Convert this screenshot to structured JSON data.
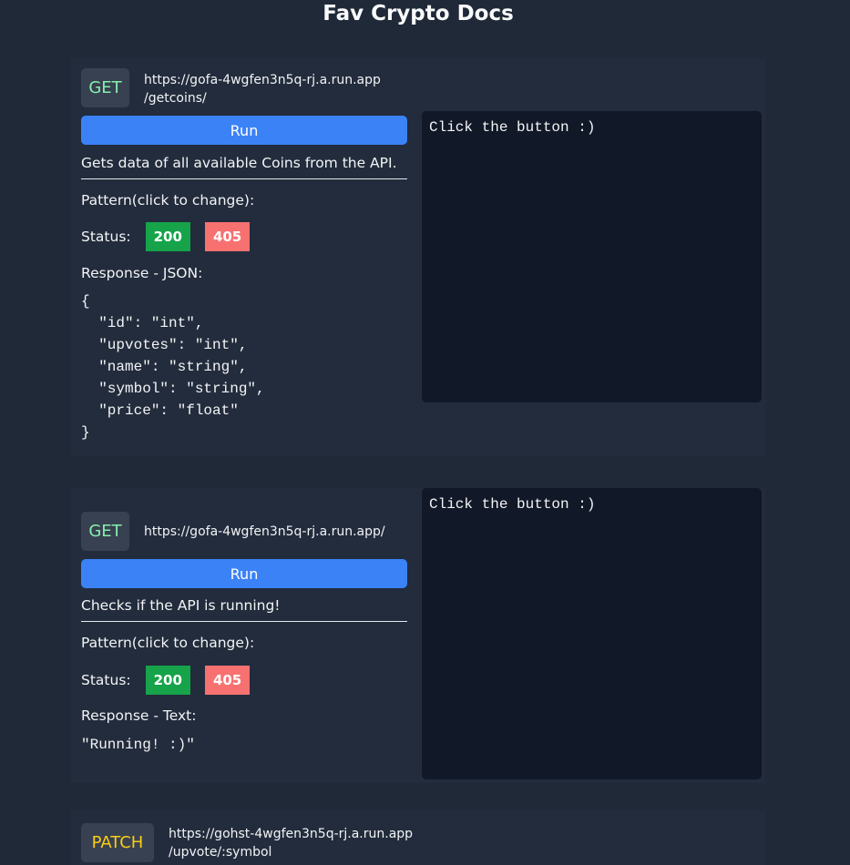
{
  "page": {
    "title": "Fav Crypto Docs"
  },
  "endpoints": [
    {
      "method": "GET",
      "url_line1": "https://gofa-4wgfen3n5q-rj.a.run.app",
      "url_line2": "/getcoins/",
      "run_label": "Run",
      "description": "Gets data of all available Coins from the API.",
      "pattern_label": "Pattern(click to change):",
      "status_label": "Status:",
      "status_ok": "200",
      "status_err": "405",
      "response_title": "Response - JSON:",
      "response_body": "{\n  \"id\": \"int\",\n  \"upvotes\": \"int\",\n  \"name\": \"string\",\n  \"symbol\": \"string\",\n  \"price\": \"float\"\n}",
      "output": "Click the button :)"
    },
    {
      "method": "GET",
      "url_line1": "https://gofa-4wgfen3n5q-rj.a.run.app/",
      "run_label": "Run",
      "description": "Checks if the API is running!",
      "pattern_label": "Pattern(click to change):",
      "status_label": "Status:",
      "status_ok": "200",
      "status_err": "405",
      "response_title": "Response - Text:",
      "response_body": "\"Running! :)\"",
      "output": "Click the button :)"
    },
    {
      "method": "PATCH",
      "url_line1": "https://gohst-4wgfen3n5q-rj.a.run.app",
      "url_line2": "/upvote/:symbol"
    }
  ],
  "colors": {
    "background": "#1f2937",
    "card": "#222c3c",
    "run_button": "#3b82f6",
    "status_ok": "#16a34a",
    "status_err": "#f87171",
    "get_method": "#86efac",
    "patch_method": "#facc15",
    "output_bg": "#111827"
  }
}
